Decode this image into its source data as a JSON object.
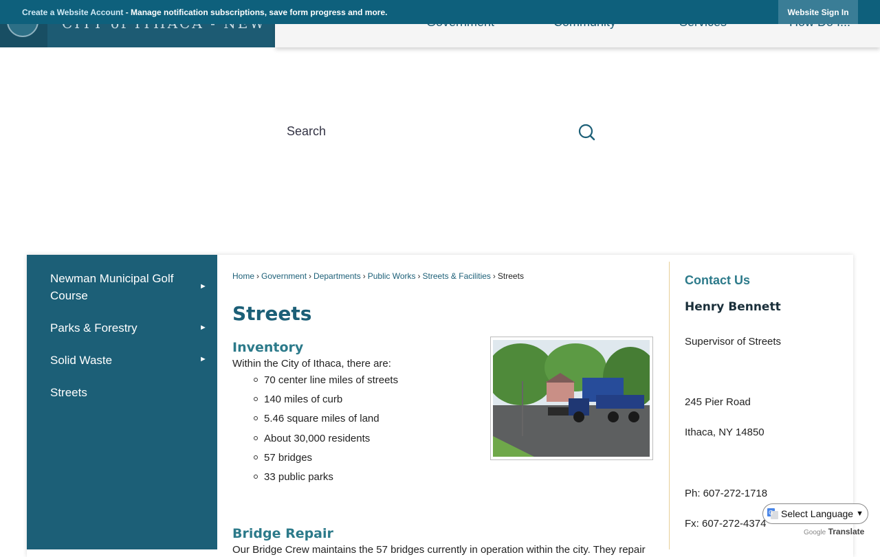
{
  "topbar": {
    "link": "Create a Website Account",
    "message": " - Manage notification subscriptions, save form progress and more.",
    "signin": "Website Sign In"
  },
  "header": {
    "logo_text": "CITY of ITHACA - NEW YORK",
    "nav": [
      "Government",
      "Community",
      "Services",
      "How Do I..."
    ]
  },
  "search": {
    "placeholder": "Search"
  },
  "sidebar": {
    "items": [
      {
        "label": "Newman Municipal Golf Course",
        "has_arrow": true
      },
      {
        "label": "Parks & Forestry",
        "has_arrow": true
      },
      {
        "label": "Solid Waste",
        "has_arrow": true
      },
      {
        "label": "Streets",
        "has_arrow": false
      }
    ]
  },
  "breadcrumb": {
    "items": [
      "Home",
      "Government",
      "Departments",
      "Public Works",
      "Streets & Facilities"
    ],
    "current": "Streets",
    "separator": "›"
  },
  "main": {
    "title": "Streets",
    "inventory": {
      "heading": "Inventory",
      "intro": "Within the City of Ithaca, there are:",
      "bullets": [
        "70 center line miles of streets",
        "140 miles of curb",
        "5.46 square miles of land",
        "About 30,000 residents",
        "57 bridges",
        "33 public parks"
      ]
    },
    "bridge": {
      "heading": "Bridge Repair",
      "text": "Our Bridge Crew maintains the 57 bridges currently in operation within the city. They repair"
    }
  },
  "contact": {
    "title": "Contact Us",
    "name": "Henry Bennett",
    "role": "Supervisor of Streets",
    "address1": "245 Pier Road",
    "address2": "Ithaca, NY 14850",
    "phone": "Ph: 607-272-1718",
    "fax": "Fx: 607-272-4374"
  },
  "translate": {
    "select_label": "Select Language",
    "powered_google": "Google",
    "powered_translate": "Translate"
  },
  "colors": {
    "primary": "#1c5f77",
    "topbar": "#0e607c",
    "heading_teal": "#2c7a8a"
  }
}
